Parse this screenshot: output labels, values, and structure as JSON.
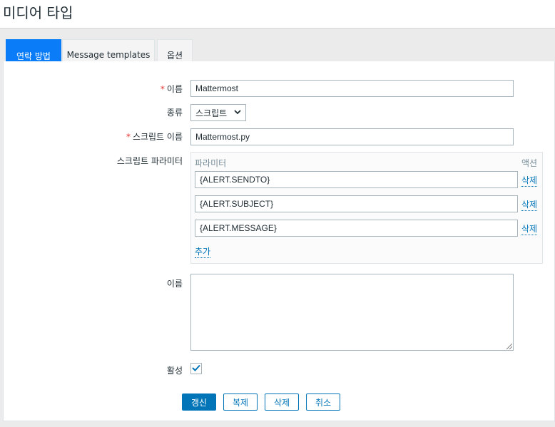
{
  "page": {
    "title": "미디어 타입"
  },
  "tabs": [
    {
      "label": "연락 방법",
      "active": true
    },
    {
      "label": "Message templates",
      "active": false
    },
    {
      "label": "옵션",
      "active": false
    }
  ],
  "form": {
    "name": {
      "label": "이름",
      "required": true,
      "value": "Mattermost"
    },
    "type": {
      "label": "종류",
      "value": "스크립트"
    },
    "script_name": {
      "label": "스크립트 이름",
      "required": true,
      "value": "Mattermost.py"
    },
    "script_params": {
      "label": "스크립트 파라미터",
      "col_param": "파라미터",
      "col_action": "액션",
      "params": [
        {
          "value": "{ALERT.SENDTO}",
          "remove": "삭제"
        },
        {
          "value": "{ALERT.SUBJECT}",
          "remove": "삭제"
        },
        {
          "value": "{ALERT.MESSAGE}",
          "remove": "삭제"
        }
      ],
      "add": "추가"
    },
    "description": {
      "label": "이름",
      "value": ""
    },
    "enabled": {
      "label": "활성",
      "checked": true
    }
  },
  "buttons": {
    "update": "갱신",
    "clone": "복제",
    "delete": "삭제",
    "cancel": "취소"
  },
  "colors": {
    "accent": "#0275b8",
    "active_tab": "#0a7cf7",
    "required": "#e33734"
  }
}
